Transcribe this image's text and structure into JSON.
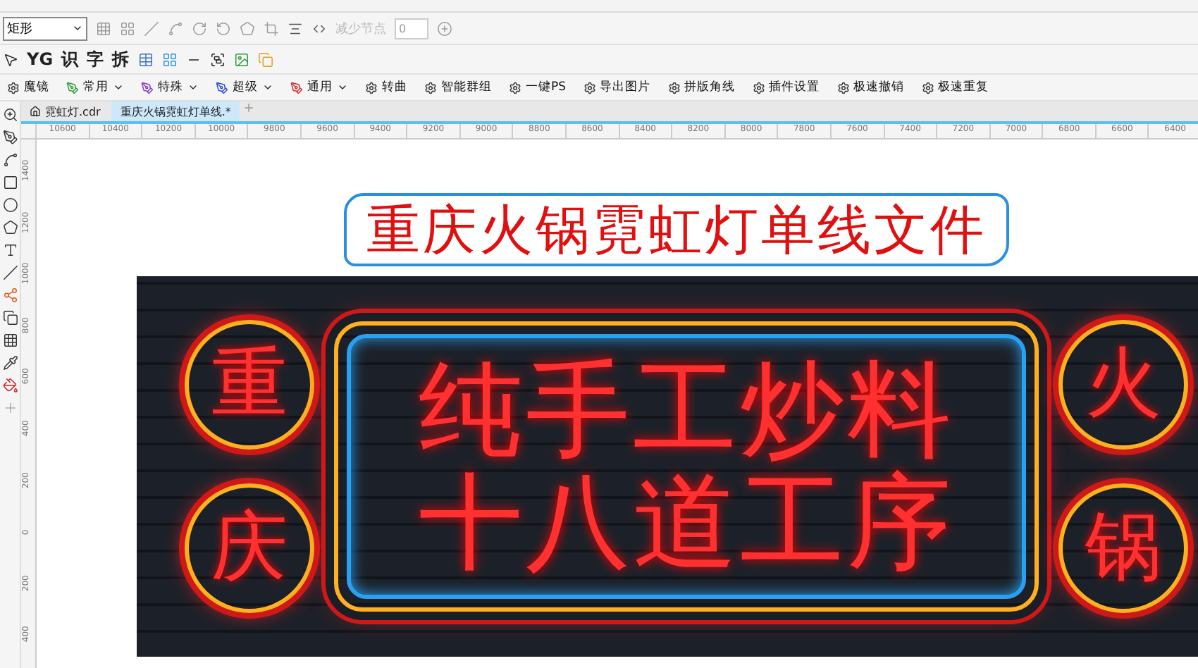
{
  "property_bar": {
    "shape_dropdown": "矩形",
    "reduce_nodes": {
      "label": "减少节点",
      "disabled": true
    },
    "node_count": "0"
  },
  "tool_row": {
    "glyphs": [
      "YG",
      "识",
      "字",
      "拆"
    ]
  },
  "plugin_bar": [
    {
      "label": "魔镜",
      "kind": "plain"
    },
    {
      "label": "常用",
      "kind": "menu",
      "color": "#2e9a3a"
    },
    {
      "label": "特殊",
      "kind": "menu",
      "color": "#8a3ad0"
    },
    {
      "label": "超级",
      "kind": "menu",
      "color": "#2a4fd0"
    },
    {
      "label": "通用",
      "kind": "menu",
      "color": "#d02a2a"
    },
    {
      "label": "转曲",
      "kind": "plain"
    },
    {
      "label": "智能群组",
      "kind": "plain"
    },
    {
      "label": "一键PS",
      "kind": "plain"
    },
    {
      "label": "导出图片",
      "kind": "plain"
    },
    {
      "label": "拼版角线",
      "kind": "plain"
    },
    {
      "label": "插件设置",
      "kind": "plain"
    },
    {
      "label": "极速撤销",
      "kind": "plain"
    },
    {
      "label": "极速重复",
      "kind": "plain"
    }
  ],
  "document_tabs": [
    {
      "label": "霓虹灯.cdr",
      "selected": false
    },
    {
      "label": "重庆火锅霓虹灯单线.*",
      "selected": true
    }
  ],
  "ruler": {
    "horizontal": [
      "10600",
      "10400",
      "10200",
      "10000",
      "9800",
      "9600",
      "9400",
      "9200",
      "9000",
      "8800",
      "8600",
      "8400",
      "8200",
      "8000",
      "7800",
      "7600",
      "7400",
      "7200",
      "7000",
      "6800",
      "6600",
      "6400"
    ],
    "vertical": [
      "1400",
      "1200",
      "1000",
      "800",
      "600",
      "400",
      "200",
      "0",
      "200",
      "400"
    ]
  },
  "canvas": {
    "title": "重庆火锅霓虹灯单线文件",
    "sign": {
      "left_circles": [
        "重",
        "庆"
      ],
      "right_circles": [
        "火",
        "锅"
      ],
      "lines": [
        "纯手工炒料",
        "十八道工序"
      ]
    }
  }
}
